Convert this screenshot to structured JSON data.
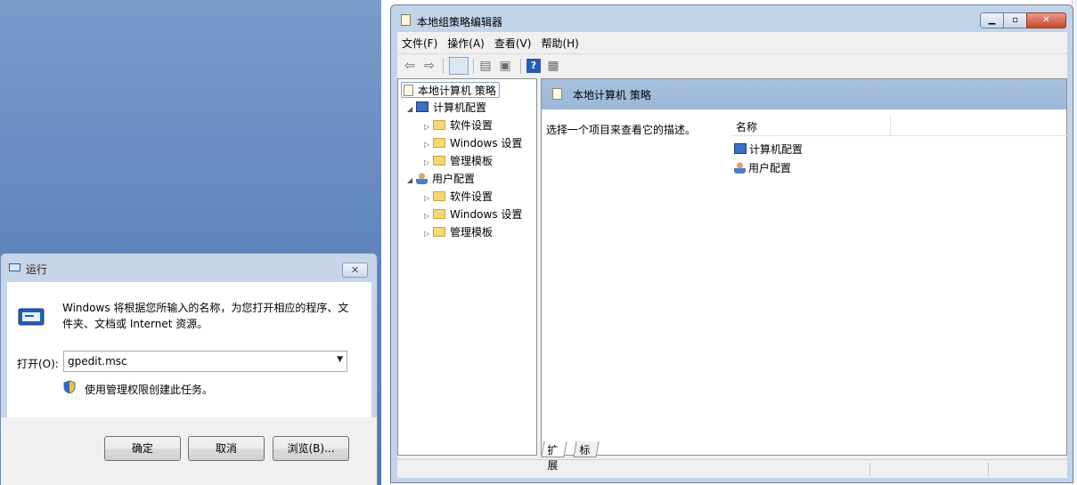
{
  "run_dialog": {
    "title": "运行",
    "description": "Windows 将根据您所输入的名称，为您打开相应的程序、文件夹、文档或 Internet 资源。",
    "open_label": "打开(O):",
    "command_value": "gpedit.msc",
    "admin_note": "使用管理权限创建此任务。",
    "buttons": {
      "ok": "确定",
      "cancel": "取消",
      "browse": "浏览(B)..."
    },
    "icons": {
      "title": "run-icon",
      "main": "run-program-icon",
      "shield": "uac-shield-icon",
      "close": "close-icon"
    }
  },
  "gpedit": {
    "title": "本地组策略编辑器",
    "menu": [
      "文件(F)",
      "操作(A)",
      "查看(V)",
      "帮助(H)"
    ],
    "toolbar_icons": [
      "back-icon",
      "forward-icon",
      "show-hide-tree-icon",
      "properties-icon",
      "export-icon",
      "help-icon",
      "show-hide-action-pane-icon"
    ],
    "tree": {
      "root": "本地计算机 策略",
      "computer_config": "计算机配置",
      "user_config": "用户配置",
      "software_settings": "软件设置",
      "windows_settings": "Windows 设置",
      "admin_templates": "管理模板"
    },
    "detail": {
      "header": "本地计算机 策略",
      "description": "选择一个项目来查看它的描述。",
      "column_name": "名称",
      "items": [
        "计算机配置",
        "用户配置"
      ]
    },
    "tabs": [
      "扩展",
      "标准"
    ],
    "window_buttons": {
      "minimize": "minimize-icon",
      "maximize": "maximize-icon",
      "close": "close-icon"
    },
    "accent_colors": {
      "header_band": "#a7c0df",
      "frame": "#c2d4ea",
      "close_button": "#c9462c"
    }
  }
}
